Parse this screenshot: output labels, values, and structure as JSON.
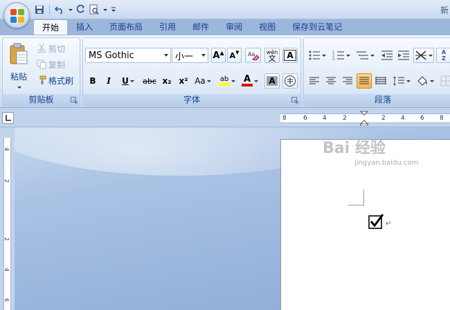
{
  "title_bar": {
    "title_fragment": "新"
  },
  "tabs": [
    {
      "label": "开始",
      "active": true
    },
    {
      "label": "插入"
    },
    {
      "label": "页面布局"
    },
    {
      "label": "引用"
    },
    {
      "label": "邮件"
    },
    {
      "label": "审阅"
    },
    {
      "label": "视图"
    },
    {
      "label": "保存到云笔记"
    }
  ],
  "clipboard": {
    "paste_label": "粘贴",
    "cut_label": "剪切",
    "copy_label": "复制",
    "format_painter_label": "格式刷",
    "group_label": "剪贴板"
  },
  "font": {
    "font_name": "MS Gothic",
    "font_size": "小一",
    "bold": "B",
    "italic": "I",
    "underline": "U",
    "strike": "abc",
    "subscript": "x₂",
    "superscript": "x²",
    "change_case": "Aa",
    "phonetic": "wén",
    "phonetic_char": "文",
    "char_border": "A",
    "char_shading": "A",
    "enclose": "字",
    "grow": "A",
    "shrink": "A",
    "highlight": "ab",
    "font_color": "A",
    "group_label": "字体",
    "highlight_color": "#ffff00",
    "font_color_value": "#e00000"
  },
  "paragraph": {
    "group_label": "段落",
    "sort": "A Z"
  },
  "ruler": {
    "horizontal_labels": [
      "8",
      "6",
      "4",
      "2",
      "2",
      "4",
      "6",
      "8"
    ],
    "vertical_labels": [
      "4",
      "2",
      "2",
      "4",
      "6"
    ]
  },
  "document": {
    "paragraph_mark": "↵"
  },
  "watermark": {
    "brand": "Bai 经验",
    "url": "jingyan.baidu.com"
  }
}
